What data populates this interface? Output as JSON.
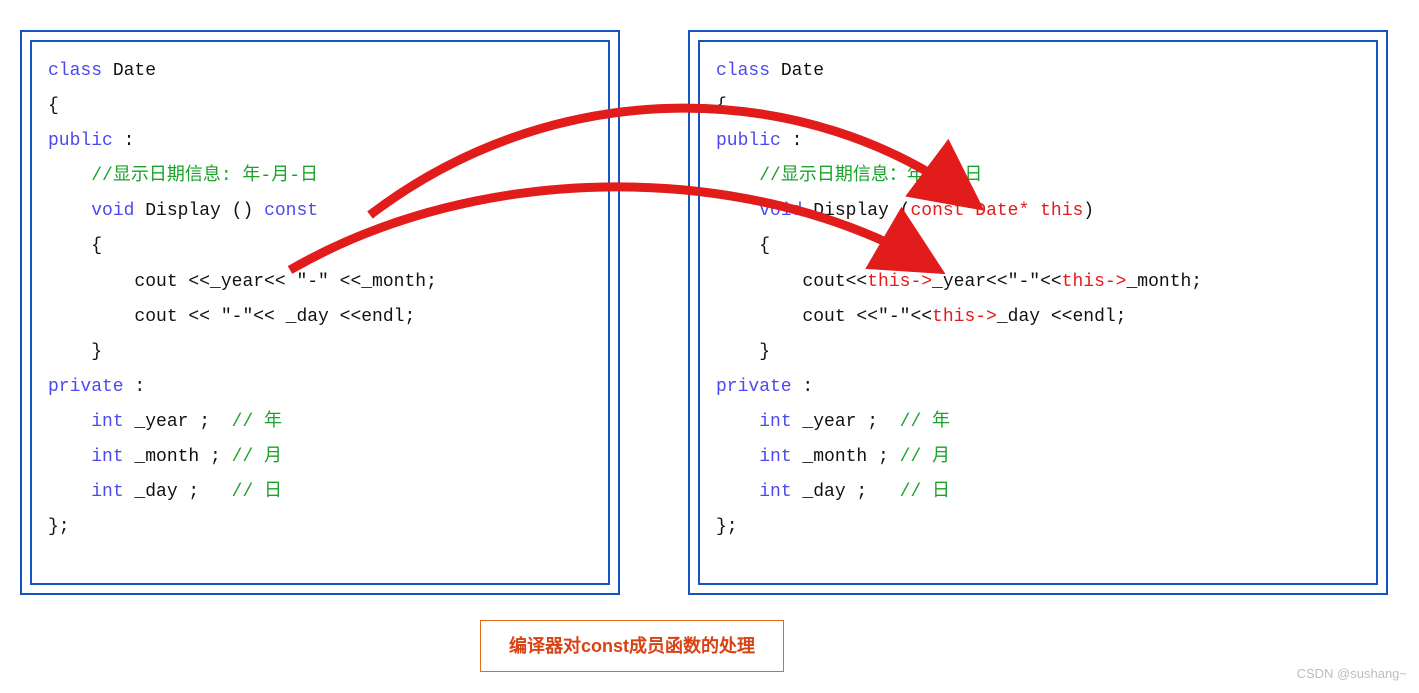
{
  "left": {
    "class_kw": "class",
    "class_name": " Date",
    "lbrace": "{",
    "public_kw": "public",
    "colon": " :",
    "comment_display": "//显示日期信息: 年-月-日",
    "void_kw": "void",
    "display_name": " Display ()",
    "const_kw": " const",
    "inner_lbrace": "{",
    "cout1": "cout <<_year<< \"-\" <<_month;",
    "cout2": "cout << \"-\"<< _day <<endl;",
    "inner_rbrace": "}",
    "private_kw": "private",
    "int_kw": "int",
    "year_decl": " _year ;  ",
    "year_comment": "// 年",
    "month_decl": " _month ; ",
    "month_comment": "// 月",
    "day_decl": " _day ;   ",
    "day_comment": "// 日",
    "class_end": "};"
  },
  "right": {
    "class_kw": "class",
    "class_name": " Date",
    "lbrace": "{",
    "public_kw": "public",
    "colon": " :",
    "comment_display": "//显示日期信息：年-月-日",
    "void_kw": "void",
    "display_name": " Display (",
    "this_param": "const Date* this",
    "display_close": ")",
    "inner_lbrace": "{",
    "cout1a": "cout<<",
    "this_arrow1": "this->",
    "cout1b": "_year<<\"-\"<<",
    "this_arrow2": "this->",
    "cout1c": "_month;",
    "cout2a": "cout <<\"-\"<<",
    "this_arrow3": "this->",
    "cout2b": "_day <<endl;",
    "inner_rbrace": "}",
    "private_kw": "private",
    "int_kw": "int",
    "year_decl": " _year ;  ",
    "year_comment": "// 年",
    "month_decl": " _month ; ",
    "month_comment": "// 月",
    "day_decl": " _day ;   ",
    "day_comment": "// 日",
    "class_end": "};"
  },
  "caption": "编译器对const成员函数的处理",
  "watermark": "CSDN @sushang~"
}
